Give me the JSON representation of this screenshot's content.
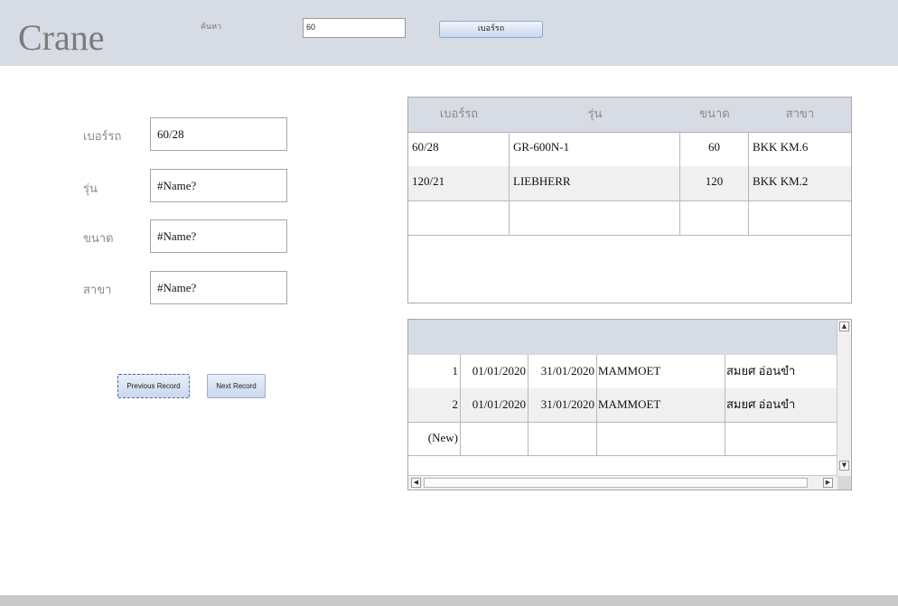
{
  "header": {
    "title": "Crane",
    "search_label": "ค้นหา",
    "search_value": "60",
    "plate_button": "เบอร์รถ"
  },
  "form": {
    "fields": [
      {
        "label": "เบอร์รถ",
        "value": "60/28"
      },
      {
        "label": "รุ่น",
        "value": "#Name?"
      },
      {
        "label": "ขนาด",
        "value": "#Name?"
      },
      {
        "label": "สาขา",
        "value": "#Name?"
      }
    ],
    "prev_button": "Previous Record",
    "next_button": "Next Record"
  },
  "crane_table": {
    "columns": [
      "เบอร์รถ",
      "รุ่น",
      "ขนาด",
      "สาขา"
    ],
    "rows": [
      [
        "60/28",
        "GR-600N-1",
        "60",
        "BKK KM.6"
      ],
      [
        "120/21",
        "LIEBHERR",
        "120",
        "BKK KM.2"
      ],
      [
        "",
        "",
        "",
        ""
      ]
    ]
  },
  "sub_table": {
    "rows": [
      [
        "1",
        "01/01/2020",
        "31/01/2020",
        "MAMMOET",
        "สมยศ อ่อนขำ"
      ],
      [
        "2",
        "01/01/2020",
        "31/01/2020",
        "MAMMOET",
        "สมยศ อ่อนขำ"
      ],
      [
        "(New)",
        "",
        "",
        "",
        ""
      ]
    ]
  },
  "icons": {
    "scroll_up": "▲",
    "scroll_down": "▼",
    "scroll_left": "◀",
    "scroll_right": "▶"
  }
}
